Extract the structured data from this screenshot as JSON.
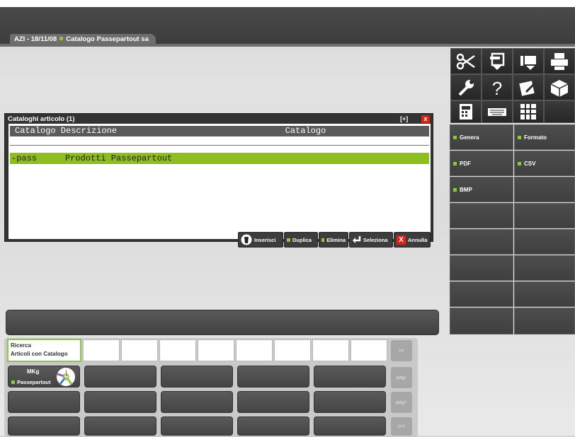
{
  "window": {
    "tab_label": "AZI - 18/11/08",
    "tab_company": "Catalogo Passepartout sa"
  },
  "toolbar": {
    "icons": [
      "scissors-icon",
      "copy-icon",
      "paste-icon",
      "print-icon",
      "wrench-icon",
      "help-icon",
      "edit-icon",
      "box-icon",
      "calculator-icon",
      "keyboard-icon",
      "grid-icon"
    ]
  },
  "actions": {
    "genera": "Genera",
    "formato": "Formato",
    "pdf": "PDF",
    "csv": "CSV",
    "bmp": "BMP"
  },
  "dialog": {
    "title": "Cataloghi articolo (1)",
    "col_header": "Catalogo Descrizione                                 Catalogo",
    "rows": [
      {
        "code": "-pass",
        "description": "Prodotti Passepartout"
      }
    ],
    "buttons": {
      "inserisci": "Inserisci",
      "duplica": "Duplica",
      "elimina": "Elimina",
      "seleziona": "Seleziona",
      "annulla": "Annulla"
    },
    "window_controls": {
      "expand": "[+]",
      "close": "x"
    }
  },
  "search": {
    "title": "Ricerca",
    "selected": "Articoli con Catalogo"
  },
  "shortcut": {
    "line1": "MKg",
    "line2": "Passepartout"
  },
  "nav": {
    "first": "<<",
    "pag_down": "pag-",
    "pag_up": "pag+",
    "last": "|<<"
  },
  "colors": {
    "accent_green": "#8ebd1f",
    "close_red": "#d9251c"
  }
}
